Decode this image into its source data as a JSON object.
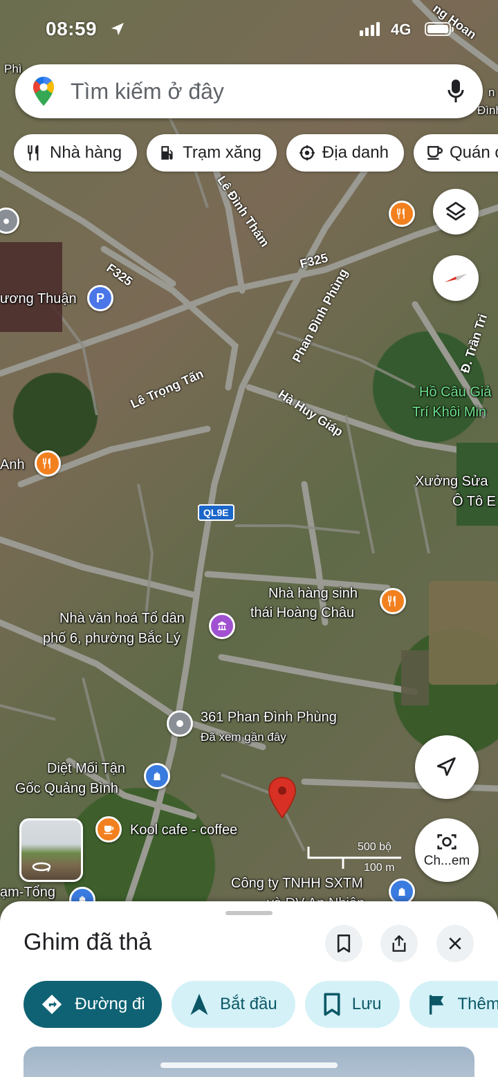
{
  "status_bar": {
    "time": "08:59",
    "network": "4G"
  },
  "search": {
    "placeholder": "Tìm kiếm ở đây"
  },
  "chips": [
    {
      "label": "Nhà hàng",
      "icon": "fork-knife-icon"
    },
    {
      "label": "Trạm xăng",
      "icon": "gas-station-icon"
    },
    {
      "label": "Địa danh",
      "icon": "landmark-icon"
    },
    {
      "label": "Quán c",
      "icon": "coffee-icon"
    }
  ],
  "map": {
    "roads": {
      "le_dinh_tham": "Lê Đình Thám",
      "f325_a": "F325",
      "f325_b": "F325",
      "phan_dinh_phung": "Phan Đình Phùng",
      "le_trong_tan": "Lê Trọng Tấn",
      "ha_huy_giap": "Hà Huy Giáp",
      "tran_tri": "Đ. Trần Tri",
      "ql9e": "QL9E"
    },
    "places": {
      "top_left_clip": "Phì",
      "top_right_clip": "ng Hoan",
      "right_clip_1": "n",
      "right_clip_2": "Đình",
      "tuong_thuan": "ương Thuận",
      "parking": "P",
      "anh": "Anh",
      "ho_cau_line1": "Hồ Câu Giả",
      "ho_cau_line2": "Trí Khôi Min",
      "xuong_sua_line1": "Xưởng Sửa",
      "xuong_sua_line2": "Ô Tô E",
      "nha_hang_line1": "Nhà hàng sinh",
      "nha_hang_line2": "thái Hoàng Châu",
      "nha_van_hoa_line1": "Nhà văn hoá Tổ dân",
      "nha_van_hoa_line2": "phố 6, phường Bắc Lý",
      "address": "361 Phan Đình Phùng",
      "address_sub": "Đã xem gần đây",
      "diet_moi_line1": "Diệt Mối Tận",
      "diet_moi_line2": "Gốc Quảng Bình",
      "kool_cafe": "Kool cafe - coffee",
      "am_tong": "ạm-Tổng",
      "cong_ty_line1": "Công ty TNHH SXTM",
      "cong_ty_line2": "và DV An Nhiên"
    },
    "scale": {
      "imperial": "500 bộ",
      "metric": "100 m"
    }
  },
  "lens_button": {
    "label": "Ch...em"
  },
  "sheet": {
    "title": "Ghim đã thả",
    "actions": [
      {
        "label": "Đường đi",
        "icon": "directions-icon",
        "primary": true
      },
      {
        "label": "Bắt đầu",
        "icon": "navigation-arrow-icon"
      },
      {
        "label": "Lưu",
        "icon": "bookmark-icon"
      },
      {
        "label": "Thêm",
        "icon": "flag-icon"
      }
    ]
  },
  "colors": {
    "primary_action": "#0e6273",
    "secondary_action_bg": "#d4f1f8",
    "pin_red": "#d93025",
    "poi_orange": "#f2801f",
    "poi_blue": "#3a7be0",
    "poi_purple": "#a050d0"
  }
}
